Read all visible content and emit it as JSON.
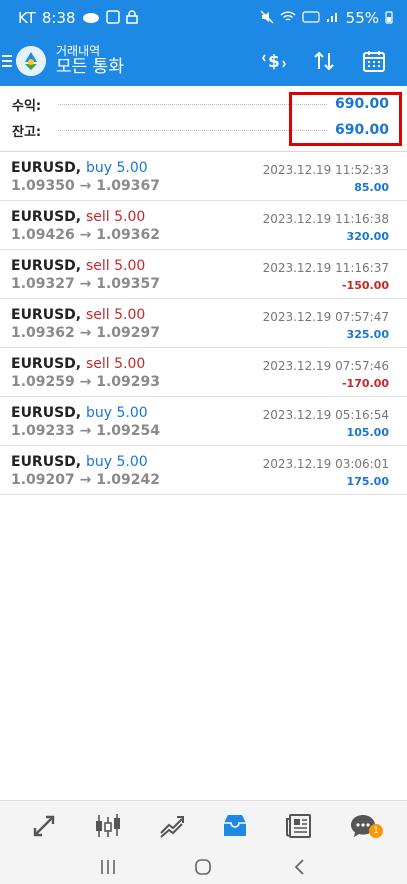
{
  "status": {
    "carrier": "KT",
    "time": "8:38",
    "battery": "55%"
  },
  "header": {
    "subtitle": "거래내역",
    "title": "모든 통화",
    "icons": [
      "menu-icon",
      "dollar-filter-icon",
      "sort-arrows-icon",
      "calendar-icon"
    ]
  },
  "summary": {
    "profit_label": "수익:",
    "profit_value": "690.00",
    "balance_label": "잔고:",
    "balance_value": "690.00"
  },
  "trades": [
    {
      "symbol": "EURUSD,",
      "side": "buy 5.00",
      "side_type": "buy",
      "prices": "1.09350 → 1.09367",
      "time": "2023.12.19 11:52:33",
      "profit": "85.00",
      "profit_sign": "pos"
    },
    {
      "symbol": "EURUSD,",
      "side": "sell 5.00",
      "side_type": "sell",
      "prices": "1.09426 → 1.09362",
      "time": "2023.12.19 11:16:38",
      "profit": "320.00",
      "profit_sign": "pos"
    },
    {
      "symbol": "EURUSD,",
      "side": "sell 5.00",
      "side_type": "sell",
      "prices": "1.09327 → 1.09357",
      "time": "2023.12.19 11:16:37",
      "profit": "-150.00",
      "profit_sign": "neg"
    },
    {
      "symbol": "EURUSD,",
      "side": "sell 5.00",
      "side_type": "sell",
      "prices": "1.09362 → 1.09297",
      "time": "2023.12.19 07:57:47",
      "profit": "325.00",
      "profit_sign": "pos"
    },
    {
      "symbol": "EURUSD,",
      "side": "sell 5.00",
      "side_type": "sell",
      "prices": "1.09259 → 1.09293",
      "time": "2023.12.19 07:57:46",
      "profit": "-170.00",
      "profit_sign": "neg"
    },
    {
      "symbol": "EURUSD,",
      "side": "buy 5.00",
      "side_type": "buy",
      "prices": "1.09233 → 1.09254",
      "time": "2023.12.19 05:16:54",
      "profit": "105.00",
      "profit_sign": "pos"
    },
    {
      "symbol": "EURUSD,",
      "side": "buy 5.00",
      "side_type": "buy",
      "prices": "1.09207 → 1.09242",
      "time": "2023.12.19 03:06:01",
      "profit": "175.00",
      "profit_sign": "pos"
    }
  ],
  "colors": {
    "header_bg": "#1e88e5",
    "buy": "#1976d2",
    "sell": "#c62828",
    "profit_pos": "#1976d2",
    "profit_neg": "#c62828",
    "highlight": "#e00000",
    "nav_active": "#1e88e5"
  },
  "bottom_nav": {
    "items": [
      "quotes-icon",
      "chart-icon",
      "trade-icon",
      "history-icon",
      "news-icon",
      "messages-icon"
    ],
    "active": "history-icon",
    "badge_count": "1"
  }
}
